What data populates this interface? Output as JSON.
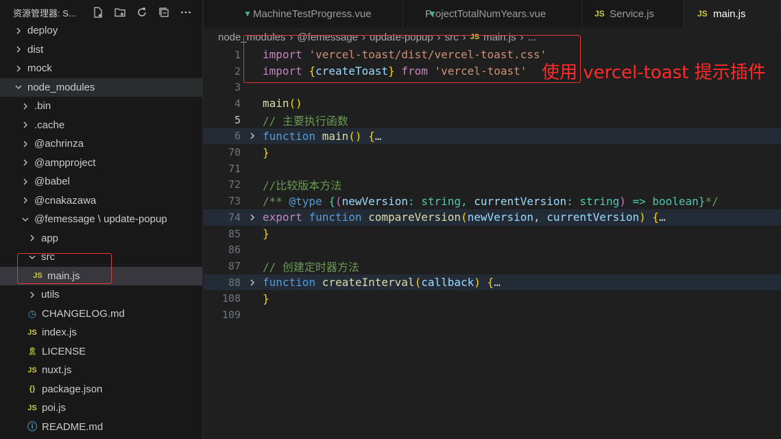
{
  "sidebar": {
    "title": "资源管理器: S...",
    "actions": [
      "new-file-icon",
      "new-folder-icon",
      "refresh-icon",
      "collapse-all-icon",
      "more-icon"
    ],
    "tree": [
      {
        "label": "deploy",
        "type": "folder",
        "expanded": false,
        "depth": 0
      },
      {
        "label": "dist",
        "type": "folder",
        "expanded": false,
        "depth": 0
      },
      {
        "label": "mock",
        "type": "folder",
        "expanded": false,
        "depth": 0
      },
      {
        "label": "node_modules",
        "type": "folder",
        "expanded": true,
        "depth": 0
      },
      {
        "label": ".bin",
        "type": "folder",
        "expanded": false,
        "depth": 1
      },
      {
        "label": ".cache",
        "type": "folder",
        "expanded": false,
        "depth": 1
      },
      {
        "label": "@achrinza",
        "type": "folder",
        "expanded": false,
        "depth": 1
      },
      {
        "label": "@ampproject",
        "type": "folder",
        "expanded": false,
        "depth": 1
      },
      {
        "label": "@babel",
        "type": "folder",
        "expanded": false,
        "depth": 1
      },
      {
        "label": "@cnakazawa",
        "type": "folder",
        "expanded": false,
        "depth": 1
      },
      {
        "label": "@femessage \\ update-popup",
        "type": "folder",
        "expanded": true,
        "depth": 1
      },
      {
        "label": "app",
        "type": "folder",
        "expanded": false,
        "depth": 2
      },
      {
        "label": "src",
        "type": "folder",
        "expanded": true,
        "depth": 2
      },
      {
        "label": "main.js",
        "type": "js",
        "depth": 3,
        "selected": true
      },
      {
        "label": "utils",
        "type": "folder",
        "expanded": false,
        "depth": 2
      },
      {
        "label": "CHANGELOG.md",
        "type": "changelog",
        "depth": 2
      },
      {
        "label": "index.js",
        "type": "js",
        "depth": 2
      },
      {
        "label": "LICENSE",
        "type": "license",
        "depth": 2
      },
      {
        "label": "nuxt.js",
        "type": "js",
        "depth": 2
      },
      {
        "label": "package.json",
        "type": "json",
        "depth": 2
      },
      {
        "label": "poi.js",
        "type": "js",
        "depth": 2
      },
      {
        "label": "README.md",
        "type": "readme",
        "depth": 2
      }
    ]
  },
  "tabs": [
    {
      "label": "MachineTestProgress.vue",
      "icon": "vue-icon",
      "active": false
    },
    {
      "label": "ProjectTotalNumYears.vue",
      "icon": "vue-icon",
      "active": false
    },
    {
      "label": "Service.js",
      "icon": "js-icon",
      "active": false
    },
    {
      "label": "main.js",
      "icon": "js-icon",
      "active": true
    }
  ],
  "breadcrumb": [
    "node_modules",
    "@femessage",
    "update-popup",
    "src",
    "main.js",
    "..."
  ],
  "editor": {
    "lines": [
      {
        "n": "1",
        "code": "import 'vercel-toast/dist/vercel-toast.css'"
      },
      {
        "n": "2",
        "code": "import {createToast} from 'vercel-toast'"
      },
      {
        "n": "3",
        "code": ""
      },
      {
        "n": "4",
        "code": "main()"
      },
      {
        "n": "5",
        "code": "// 主要执行函数"
      },
      {
        "n": "6",
        "code": "function main() {…",
        "folded": true
      },
      {
        "n": "70",
        "code": "}"
      },
      {
        "n": "71",
        "code": ""
      },
      {
        "n": "72",
        "code": "//比较版本方法"
      },
      {
        "n": "73",
        "code": "/** @type {(newVersion: string, currentVersion: string) => boolean}*/"
      },
      {
        "n": "74",
        "code": "export function compareVersion(newVersion, currentVersion) {…",
        "folded": true
      },
      {
        "n": "85",
        "code": "}"
      },
      {
        "n": "86",
        "code": ""
      },
      {
        "n": "87",
        "code": "// 创建定时器方法"
      },
      {
        "n": "88",
        "code": "function createInterval(callback) {…",
        "folded": true
      },
      {
        "n": "108",
        "code": "}"
      },
      {
        "n": "109",
        "code": ""
      }
    ],
    "current_line": "5"
  },
  "annotation": "使用 vercel-toast 提示插件",
  "colors": {
    "annotation": "#ff2a2a",
    "keyword": "#569cd6",
    "string": "#ce9178",
    "function": "#dcdcaa",
    "comment": "#6a9955",
    "variable": "#9cdcfe"
  }
}
